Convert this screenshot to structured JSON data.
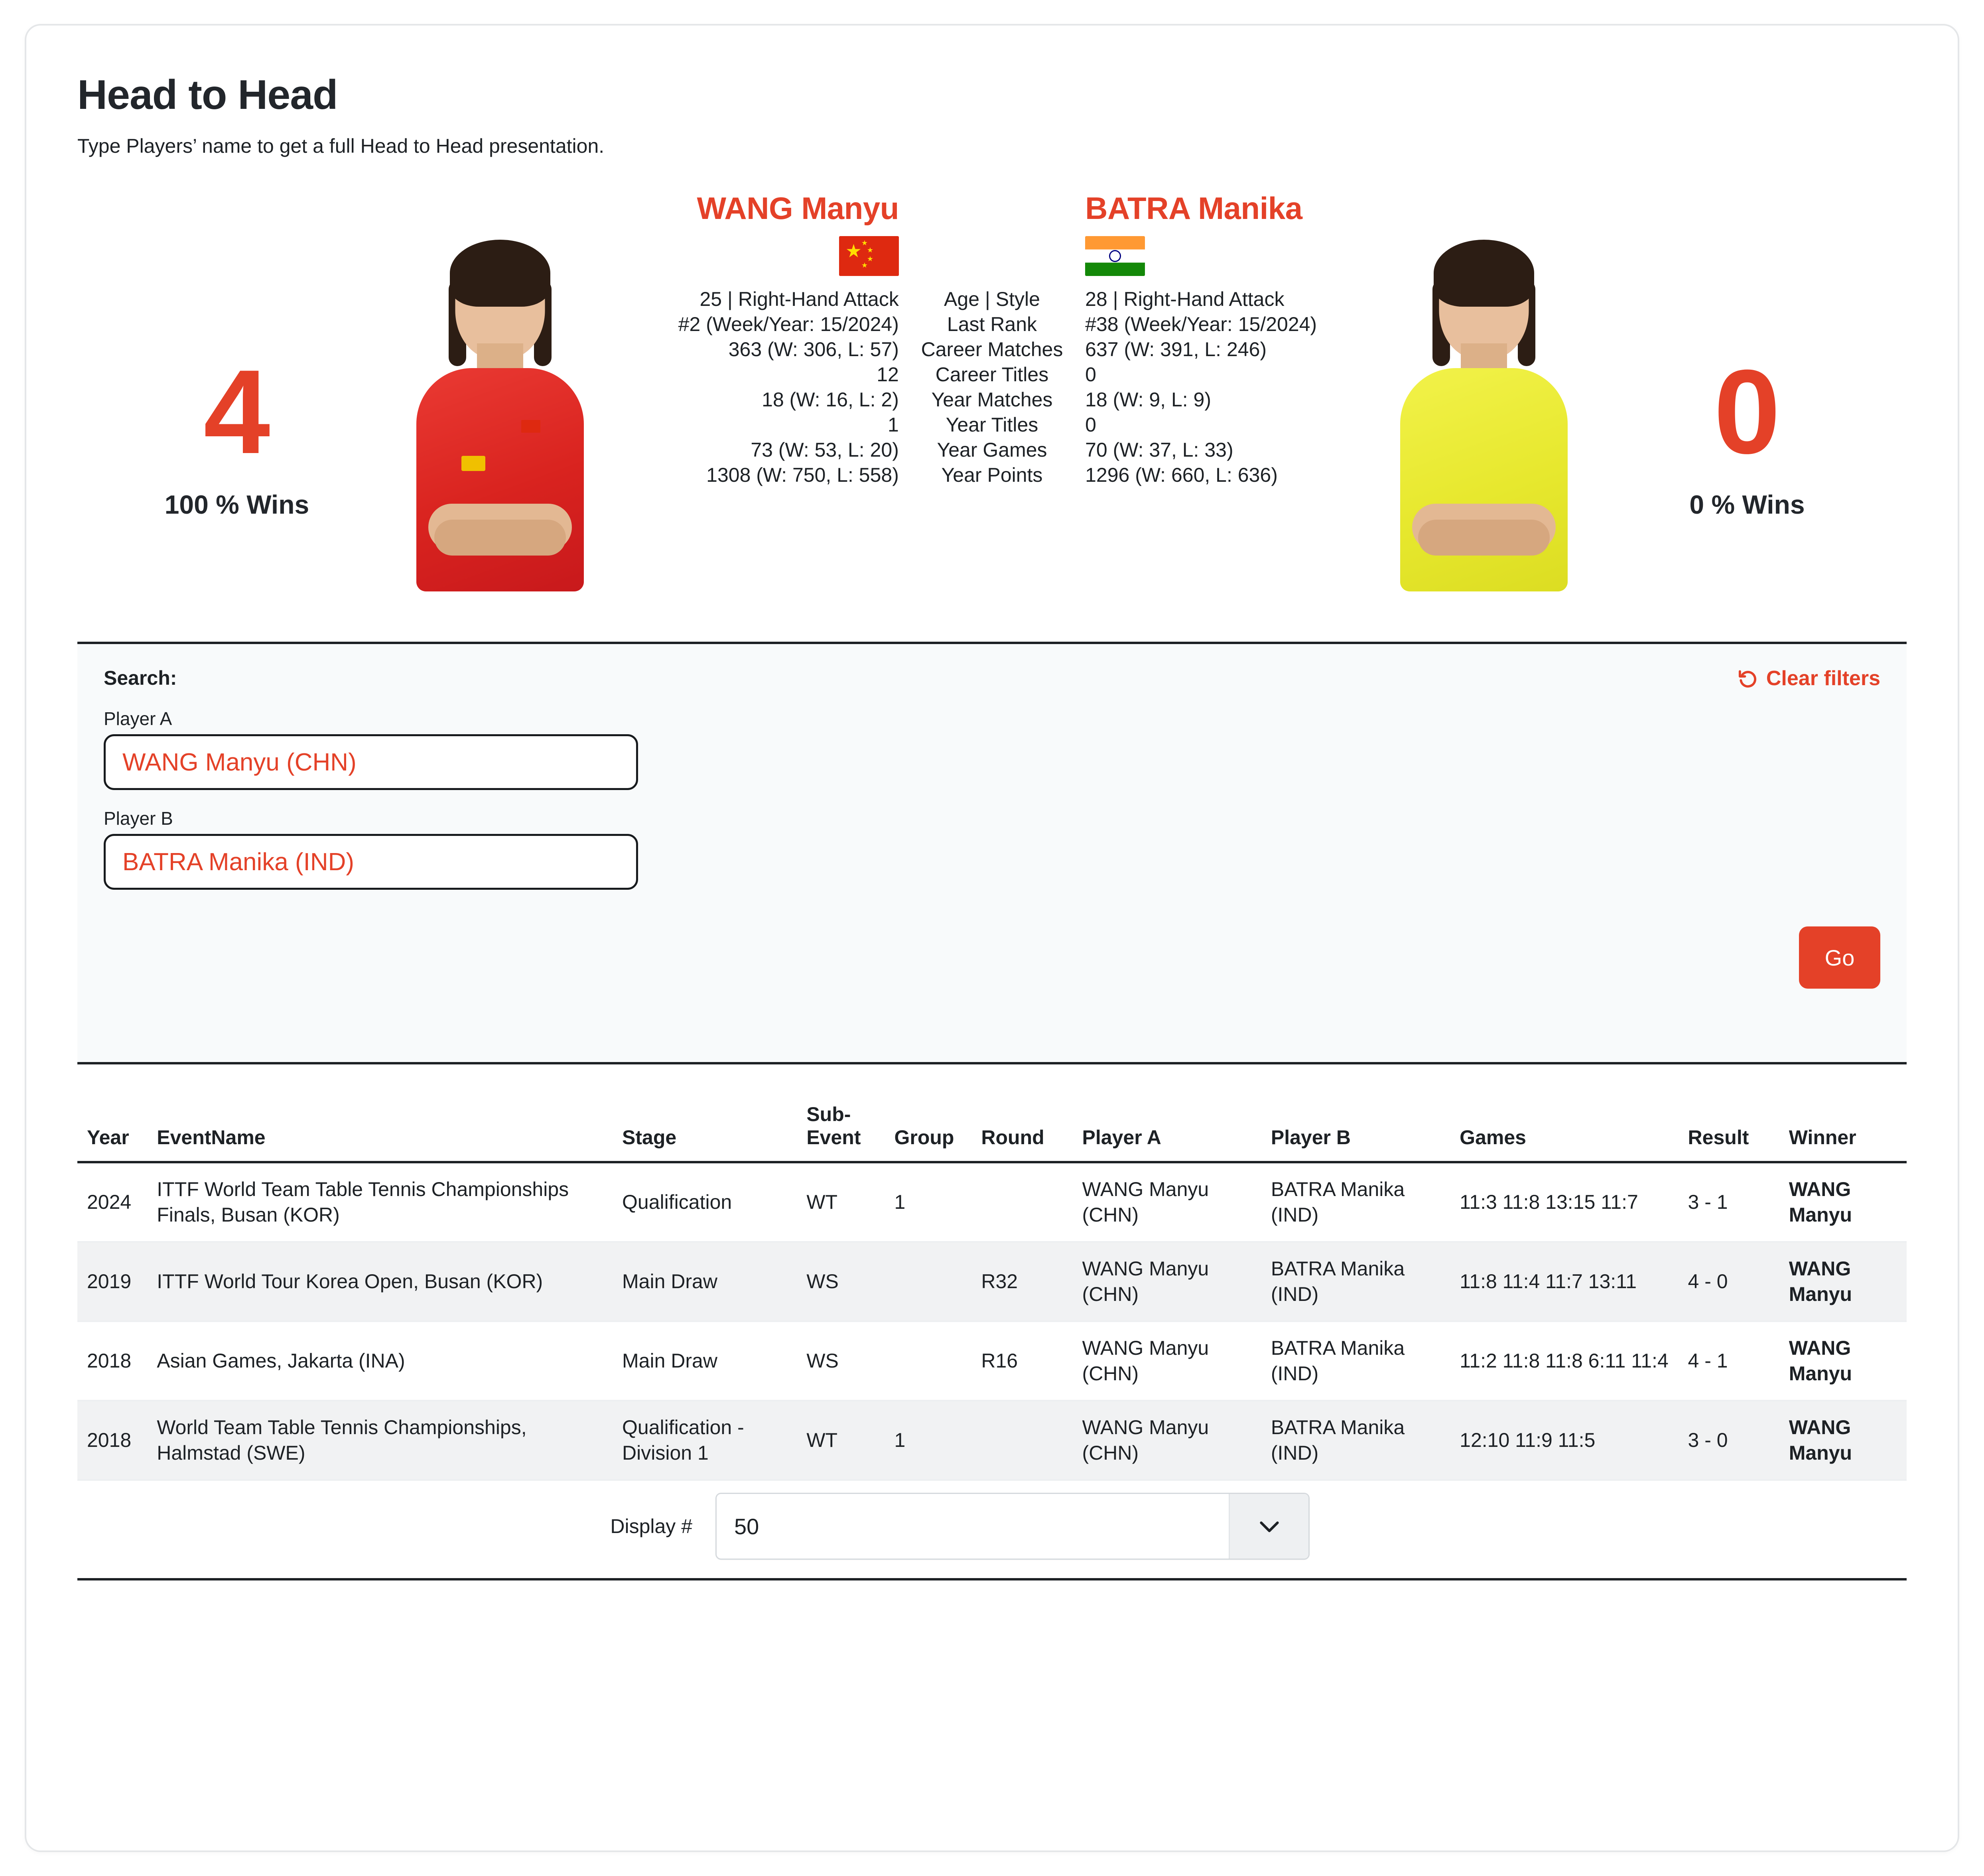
{
  "header": {
    "title": "Head to Head",
    "subtitle": "Type Players’ name to get a full Head to Head presentation."
  },
  "h2h": {
    "left": {
      "name": "WANG Manyu",
      "flag": "cn-flag-icon",
      "score": "4",
      "pct_wins": "100 % Wins",
      "age_style": "25 | Right-Hand Attack",
      "last_rank": "#2 (Week/Year: 15/2024)",
      "career_matches": "363 (W: 306, L: 57)",
      "career_titles": "12",
      "year_matches": "18 (W: 16, L: 2)",
      "year_titles": "1",
      "year_games": "73 (W: 53, L: 20)",
      "year_points": "1308 (W: 750, L: 558)"
    },
    "labels": {
      "age_style": "Age | Style",
      "last_rank": "Last Rank",
      "career_matches": "Career Matches",
      "career_titles": "Career Titles",
      "year_matches": "Year Matches",
      "year_titles": "Year Titles",
      "year_games": "Year Games",
      "year_points": "Year Points"
    },
    "right": {
      "name": "BATRA Manika",
      "flag": "in-flag-icon",
      "score": "0",
      "pct_wins": "0 % Wins",
      "age_style": "28 | Right-Hand Attack",
      "last_rank": "#38 (Week/Year: 15/2024)",
      "career_matches": "637 (W: 391, L: 246)",
      "career_titles": "0",
      "year_matches": "18 (W: 9, L: 9)",
      "year_titles": "0",
      "year_games": "70 (W: 37, L: 33)",
      "year_points": "1296 (W: 660, L: 636)"
    }
  },
  "filters": {
    "search_label": "Search:",
    "clear_filters_label": "Clear filters",
    "player_a_label": "Player A",
    "player_a_value": "WANG Manyu (CHN)",
    "player_a_placeholder": "Player A",
    "player_b_label": "Player B",
    "player_b_value": "BATRA Manika (IND)",
    "player_b_placeholder": "Player B",
    "go_label": "Go"
  },
  "table": {
    "columns": [
      "Year",
      "EventName",
      "Stage",
      "Sub-Event",
      "Group",
      "Round",
      "Player A",
      "Player B",
      "Games",
      "Result",
      "Winner"
    ],
    "rows": [
      {
        "year": "2024",
        "event": "ITTF World Team Table Tennis Championships Finals, Busan (KOR)",
        "stage": "Qualification",
        "sub_event": "WT",
        "group": "1",
        "round": "",
        "player_a": "WANG Manyu (CHN)",
        "player_b": "BATRA Manika (IND)",
        "games": "11:3 11:8 13:15 11:7",
        "result": "3 - 1",
        "winner": "WANG Manyu"
      },
      {
        "year": "2019",
        "event": "ITTF World Tour Korea Open, Busan (KOR)",
        "stage": "Main Draw",
        "sub_event": "WS",
        "group": "",
        "round": "R32",
        "player_a": "WANG Manyu (CHN)",
        "player_b": "BATRA Manika (IND)",
        "games": "11:8 11:4 11:7 13:11",
        "result": "4 - 0",
        "winner": "WANG Manyu"
      },
      {
        "year": "2018",
        "event": "Asian Games, Jakarta (INA)",
        "stage": "Main Draw",
        "sub_event": "WS",
        "group": "",
        "round": "R16",
        "player_a": "WANG Manyu (CHN)",
        "player_b": "BATRA Manika (IND)",
        "games": "11:2 11:8 11:8 6:11 11:4",
        "result": "4 - 1",
        "winner": "WANG Manyu"
      },
      {
        "year": "2018",
        "event": "World Team Table Tennis Championships, Halmstad (SWE)",
        "stage": "Qualification - Division 1",
        "sub_event": "WT",
        "group": "1",
        "round": "",
        "player_a": "WANG Manyu (CHN)",
        "player_b": "BATRA Manika (IND)",
        "games": "12:10 11:9 11:5",
        "result": "3 - 0",
        "winner": "WANG Manyu"
      }
    ]
  },
  "footer": {
    "display_label": "Display #",
    "display_value": "50"
  },
  "colors": {
    "accent": "#e44128",
    "text": "#1d2125",
    "panel_bg": "#f8fafb",
    "row_alt": "#f1f2f3"
  }
}
